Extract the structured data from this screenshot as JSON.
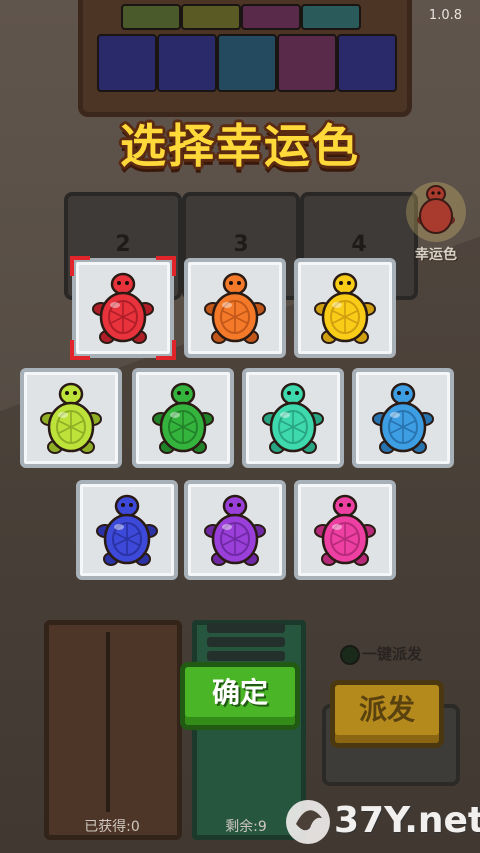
{
  "version": "1.0.8",
  "title": "选择幸运色",
  "slots": [
    "2",
    "3",
    "4"
  ],
  "lucky": {
    "label": "幸运色",
    "color": "#a83a2e"
  },
  "colors": [
    {
      "name": "red",
      "hex": "#e8323c",
      "dark": "#b01e27",
      "selected": true
    },
    {
      "name": "orange",
      "hex": "#f47a2a",
      "dark": "#c2571a",
      "selected": false
    },
    {
      "name": "yellow",
      "hex": "#f9cc17",
      "dark": "#cf9f10",
      "selected": false
    },
    {
      "name": "lime",
      "hex": "#bde33a",
      "dark": "#8fae26",
      "selected": false
    },
    {
      "name": "green",
      "hex": "#35b43d",
      "dark": "#228229",
      "selected": false
    },
    {
      "name": "teal",
      "hex": "#3fd9ae",
      "dark": "#28a582",
      "selected": false
    },
    {
      "name": "blue",
      "hex": "#3d9ee4",
      "dark": "#2874b0",
      "selected": false
    },
    {
      "name": "indigo",
      "hex": "#3d49d9",
      "dark": "#2a32a4",
      "selected": false
    },
    {
      "name": "purple",
      "hex": "#9a3fd9",
      "dark": "#7029a4",
      "selected": false
    },
    {
      "name": "pink",
      "hex": "#ee3fa3",
      "dark": "#b72a7a",
      "selected": false
    }
  ],
  "confirm_label": "确定",
  "one_click_label": "一键派发",
  "dispatch_label": "派发",
  "obtained_label": "已获得:0",
  "remaining_label": "剩余:9",
  "watermark": "37Y.net"
}
